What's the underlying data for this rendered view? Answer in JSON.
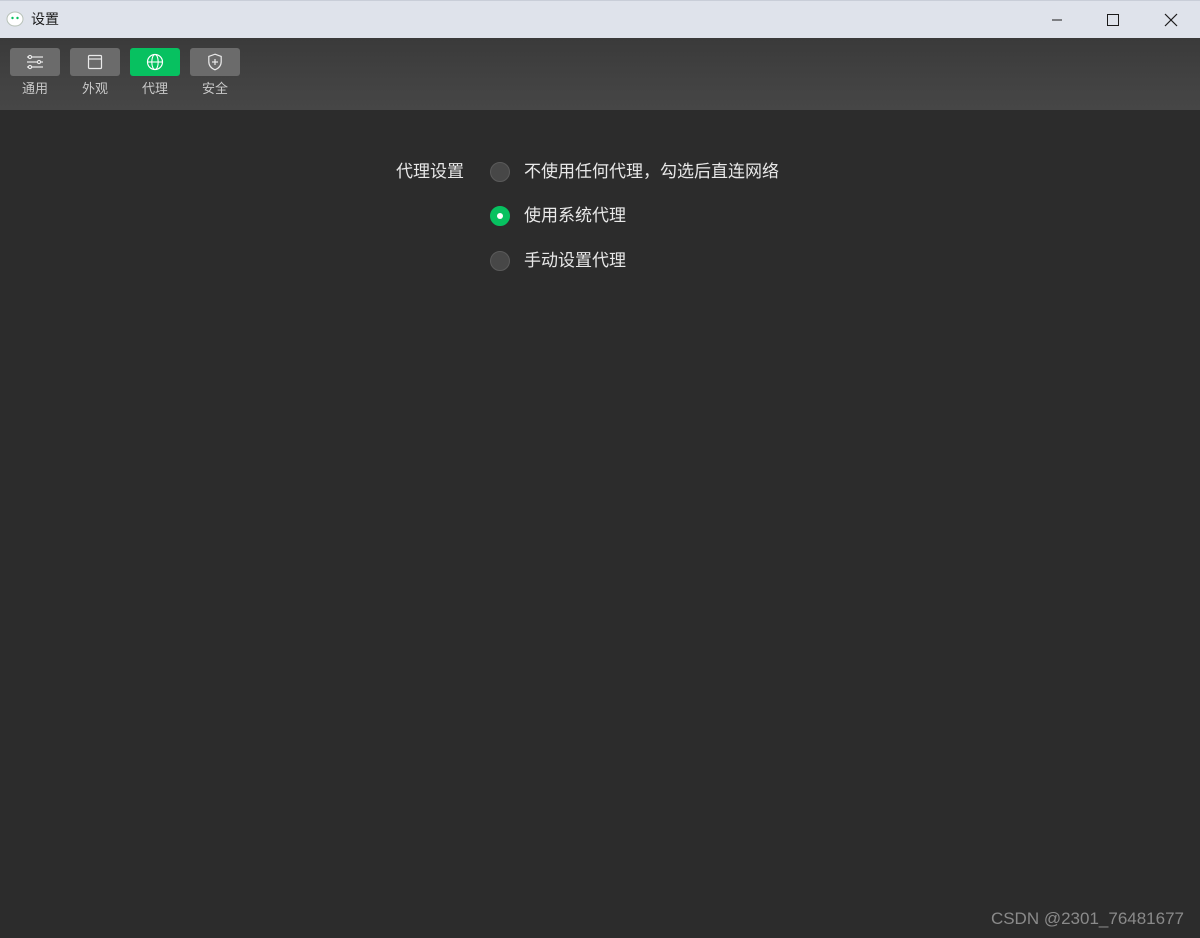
{
  "window": {
    "title": "设置"
  },
  "toolbar": {
    "items": [
      {
        "label": "通用",
        "icon": "sliders-icon",
        "active": false
      },
      {
        "label": "外观",
        "icon": "window-icon",
        "active": false
      },
      {
        "label": "代理",
        "icon": "globe-icon",
        "active": true
      },
      {
        "label": "安全",
        "icon": "shield-icon",
        "active": false
      }
    ]
  },
  "proxy": {
    "section_label": "代理设置",
    "options": [
      {
        "label": "不使用任何代理，勾选后直连网络",
        "checked": false
      },
      {
        "label": "使用系统代理",
        "checked": true
      },
      {
        "label": "手动设置代理",
        "checked": false
      }
    ]
  },
  "watermark": "CSDN @2301_76481677",
  "colors": {
    "accent": "#07c160",
    "background": "#2c2c2c",
    "titlebar": "#dfe3eb"
  }
}
